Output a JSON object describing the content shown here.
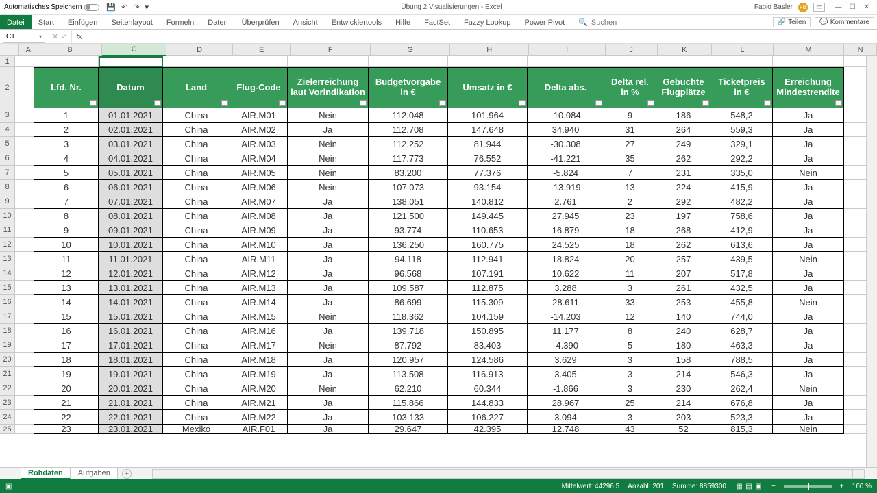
{
  "titlebar": {
    "autosave": "Automatisches Speichern",
    "doc_title": "Übung 2 Visualisierungen  -  Excel",
    "user": "Fabio Basler",
    "qat": {
      "save": "💾",
      "undo": "↶",
      "redo": "↷",
      "custom": "▾"
    }
  },
  "ribbon": {
    "tabs": [
      "Datei",
      "Start",
      "Einfügen",
      "Seitenlayout",
      "Formeln",
      "Daten",
      "Überprüfen",
      "Ansicht",
      "Entwicklertools",
      "Hilfe",
      "FactSet",
      "Fuzzy Lookup",
      "Power Pivot"
    ],
    "search": "Suchen",
    "share": "Teilen",
    "comments": "Kommentare"
  },
  "name_box": "C1",
  "columns": [
    "A",
    "B",
    "C",
    "D",
    "E",
    "F",
    "G",
    "H",
    "I",
    "J",
    "K",
    "L",
    "M",
    "N"
  ],
  "col_widths": [
    "wA",
    "wB",
    "wC",
    "wD",
    "wE",
    "wF",
    "wG",
    "wH",
    "wI",
    "wJ",
    "wK",
    "wL",
    "wM",
    "wN"
  ],
  "row_numbers": [
    1,
    2,
    3,
    4,
    5,
    6,
    7,
    8,
    9,
    10,
    11,
    12,
    13,
    14,
    15,
    16,
    17,
    18,
    19,
    20,
    21,
    22,
    23,
    24,
    25
  ],
  "headers": [
    "Lfd. Nr.",
    "Datum",
    "Land",
    "Flug-Code",
    "Zielerreichung laut Vorindikation",
    "Budgetvorgabe in €",
    "Umsatz in €",
    "Delta abs.",
    "Delta rel. in %",
    "Gebuchte Flugplätze",
    "Ticketpreis in €",
    "Erreichung Mindestrendite"
  ],
  "chart_data": {
    "type": "table",
    "rows": [
      {
        "nr": 1,
        "datum": "01.01.2021",
        "land": "China",
        "code": "AIR.M01",
        "ziel": "Nein",
        "budget": "112.048",
        "umsatz": "101.964",
        "dabs": "-10.084",
        "drel": 9,
        "flug": 186,
        "ticket": "548,2",
        "err": "Ja"
      },
      {
        "nr": 2,
        "datum": "02.01.2021",
        "land": "China",
        "code": "AIR.M02",
        "ziel": "Ja",
        "budget": "112.708",
        "umsatz": "147.648",
        "dabs": "34.940",
        "drel": 31,
        "flug": 264,
        "ticket": "559,3",
        "err": "Ja"
      },
      {
        "nr": 3,
        "datum": "03.01.2021",
        "land": "China",
        "code": "AIR.M03",
        "ziel": "Nein",
        "budget": "112.252",
        "umsatz": "81.944",
        "dabs": "-30.308",
        "drel": 27,
        "flug": 249,
        "ticket": "329,1",
        "err": "Ja"
      },
      {
        "nr": 4,
        "datum": "04.01.2021",
        "land": "China",
        "code": "AIR.M04",
        "ziel": "Nein",
        "budget": "117.773",
        "umsatz": "76.552",
        "dabs": "-41.221",
        "drel": 35,
        "flug": 262,
        "ticket": "292,2",
        "err": "Ja"
      },
      {
        "nr": 5,
        "datum": "05.01.2021",
        "land": "China",
        "code": "AIR.M05",
        "ziel": "Nein",
        "budget": "83.200",
        "umsatz": "77.376",
        "dabs": "-5.824",
        "drel": 7,
        "flug": 231,
        "ticket": "335,0",
        "err": "Nein"
      },
      {
        "nr": 6,
        "datum": "06.01.2021",
        "land": "China",
        "code": "AIR.M06",
        "ziel": "Nein",
        "budget": "107.073",
        "umsatz": "93.154",
        "dabs": "-13.919",
        "drel": 13,
        "flug": 224,
        "ticket": "415,9",
        "err": "Ja"
      },
      {
        "nr": 7,
        "datum": "07.01.2021",
        "land": "China",
        "code": "AIR.M07",
        "ziel": "Ja",
        "budget": "138.051",
        "umsatz": "140.812",
        "dabs": "2.761",
        "drel": 2,
        "flug": 292,
        "ticket": "482,2",
        "err": "Ja"
      },
      {
        "nr": 8,
        "datum": "08.01.2021",
        "land": "China",
        "code": "AIR.M08",
        "ziel": "Ja",
        "budget": "121.500",
        "umsatz": "149.445",
        "dabs": "27.945",
        "drel": 23,
        "flug": 197,
        "ticket": "758,6",
        "err": "Ja"
      },
      {
        "nr": 9,
        "datum": "09.01.2021",
        "land": "China",
        "code": "AIR.M09",
        "ziel": "Ja",
        "budget": "93.774",
        "umsatz": "110.653",
        "dabs": "16.879",
        "drel": 18,
        "flug": 268,
        "ticket": "412,9",
        "err": "Ja"
      },
      {
        "nr": 10,
        "datum": "10.01.2021",
        "land": "China",
        "code": "AIR.M10",
        "ziel": "Ja",
        "budget": "136.250",
        "umsatz": "160.775",
        "dabs": "24.525",
        "drel": 18,
        "flug": 262,
        "ticket": "613,6",
        "err": "Ja"
      },
      {
        "nr": 11,
        "datum": "11.01.2021",
        "land": "China",
        "code": "AIR.M11",
        "ziel": "Ja",
        "budget": "94.118",
        "umsatz": "112.941",
        "dabs": "18.824",
        "drel": 20,
        "flug": 257,
        "ticket": "439,5",
        "err": "Nein"
      },
      {
        "nr": 12,
        "datum": "12.01.2021",
        "land": "China",
        "code": "AIR.M12",
        "ziel": "Ja",
        "budget": "96.568",
        "umsatz": "107.191",
        "dabs": "10.622",
        "drel": 11,
        "flug": 207,
        "ticket": "517,8",
        "err": "Ja"
      },
      {
        "nr": 13,
        "datum": "13.01.2021",
        "land": "China",
        "code": "AIR.M13",
        "ziel": "Ja",
        "budget": "109.587",
        "umsatz": "112.875",
        "dabs": "3.288",
        "drel": 3,
        "flug": 261,
        "ticket": "432,5",
        "err": "Ja"
      },
      {
        "nr": 14,
        "datum": "14.01.2021",
        "land": "China",
        "code": "AIR.M14",
        "ziel": "Ja",
        "budget": "86.699",
        "umsatz": "115.309",
        "dabs": "28.611",
        "drel": 33,
        "flug": 253,
        "ticket": "455,8",
        "err": "Nein"
      },
      {
        "nr": 15,
        "datum": "15.01.2021",
        "land": "China",
        "code": "AIR.M15",
        "ziel": "Nein",
        "budget": "118.362",
        "umsatz": "104.159",
        "dabs": "-14.203",
        "drel": 12,
        "flug": 140,
        "ticket": "744,0",
        "err": "Ja"
      },
      {
        "nr": 16,
        "datum": "16.01.2021",
        "land": "China",
        "code": "AIR.M16",
        "ziel": "Ja",
        "budget": "139.718",
        "umsatz": "150.895",
        "dabs": "11.177",
        "drel": 8,
        "flug": 240,
        "ticket": "628,7",
        "err": "Ja"
      },
      {
        "nr": 17,
        "datum": "17.01.2021",
        "land": "China",
        "code": "AIR.M17",
        "ziel": "Nein",
        "budget": "87.792",
        "umsatz": "83.403",
        "dabs": "-4.390",
        "drel": 5,
        "flug": 180,
        "ticket": "463,3",
        "err": "Ja"
      },
      {
        "nr": 18,
        "datum": "18.01.2021",
        "land": "China",
        "code": "AIR.M18",
        "ziel": "Ja",
        "budget": "120.957",
        "umsatz": "124.586",
        "dabs": "3.629",
        "drel": 3,
        "flug": 158,
        "ticket": "788,5",
        "err": "Ja"
      },
      {
        "nr": 19,
        "datum": "19.01.2021",
        "land": "China",
        "code": "AIR.M19",
        "ziel": "Ja",
        "budget": "113.508",
        "umsatz": "116.913",
        "dabs": "3.405",
        "drel": 3,
        "flug": 214,
        "ticket": "546,3",
        "err": "Ja"
      },
      {
        "nr": 20,
        "datum": "20.01.2021",
        "land": "China",
        "code": "AIR.M20",
        "ziel": "Nein",
        "budget": "62.210",
        "umsatz": "60.344",
        "dabs": "-1.866",
        "drel": 3,
        "flug": 230,
        "ticket": "262,4",
        "err": "Nein"
      },
      {
        "nr": 21,
        "datum": "21.01.2021",
        "land": "China",
        "code": "AIR.M21",
        "ziel": "Ja",
        "budget": "115.866",
        "umsatz": "144.833",
        "dabs": "28.967",
        "drel": 25,
        "flug": 214,
        "ticket": "676,8",
        "err": "Ja"
      },
      {
        "nr": 22,
        "datum": "22.01.2021",
        "land": "China",
        "code": "AIR.M22",
        "ziel": "Ja",
        "budget": "103.133",
        "umsatz": "106.227",
        "dabs": "3.094",
        "drel": 3,
        "flug": 203,
        "ticket": "523,3",
        "err": "Ja"
      },
      {
        "nr": 23,
        "datum": "23.01.2021",
        "land": "Mexiko",
        "code": "AIR.F01",
        "ziel": "Ja",
        "budget": "29.647",
        "umsatz": "42.395",
        "dabs": "12.748",
        "drel": 43,
        "flug": 52,
        "ticket": "815,3",
        "err": "Nein"
      }
    ]
  },
  "sheets": [
    "Rohdaten",
    "Aufgaben"
  ],
  "status": {
    "avg_label": "Mittelwert:",
    "avg": "44296,5",
    "count_label": "Anzahl:",
    "count": "201",
    "sum_label": "Summe:",
    "sum": "8859300",
    "zoom": "160 %"
  }
}
